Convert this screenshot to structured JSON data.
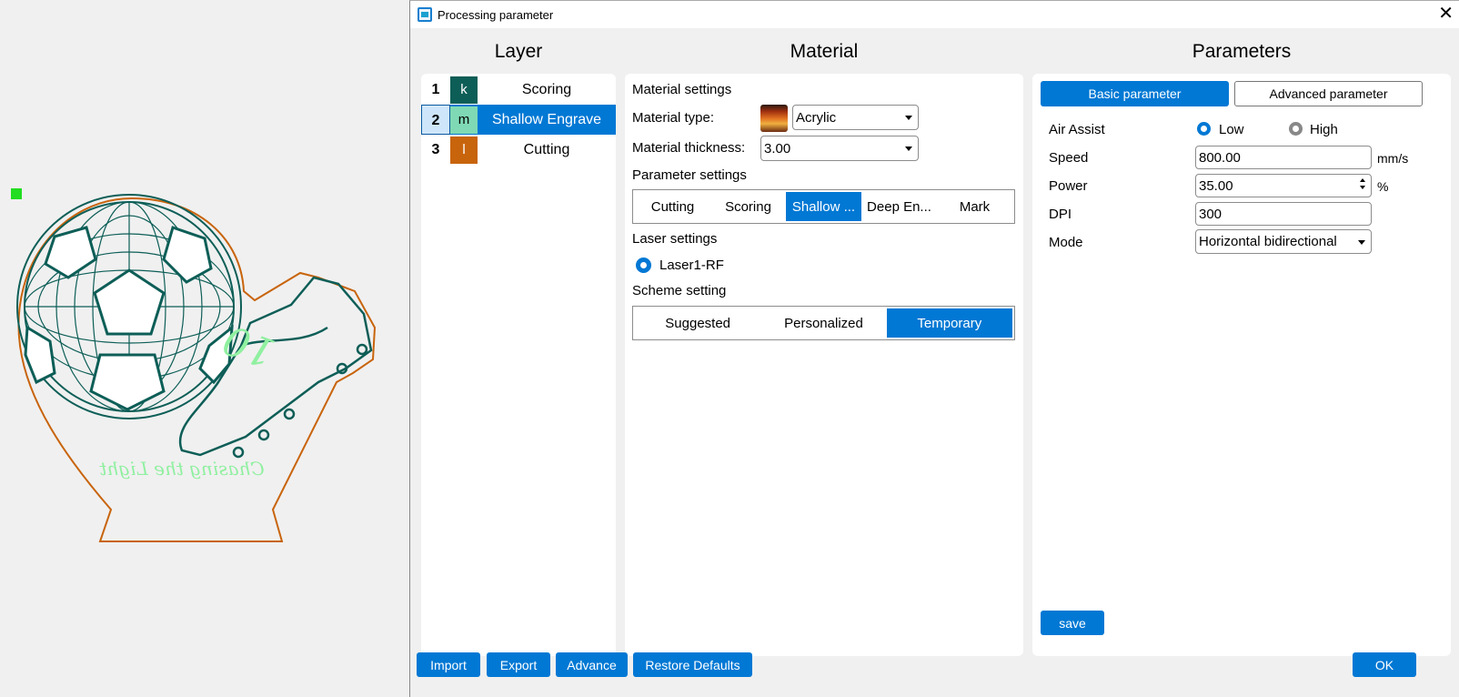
{
  "dialog": {
    "title": "Processing parameter",
    "close_glyph": "✕"
  },
  "columns": {
    "layer": "Layer",
    "material": "Material",
    "parameters": "Parameters"
  },
  "layers": [
    {
      "num": "1",
      "code": "k",
      "name": "Scoring",
      "color": "#0d5e57"
    },
    {
      "num": "2",
      "code": "m",
      "name": "Shallow Engrave",
      "color": "#7fd9b4",
      "selected": true
    },
    {
      "num": "3",
      "code": "l",
      "name": "Cutting",
      "color": "#c8640c"
    }
  ],
  "material": {
    "settings_label": "Material settings",
    "type_label": "Material type:",
    "type_value": "Acrylic",
    "thickness_label": "Material thickness:",
    "thickness_value": "3.00",
    "param_settings_label": "Parameter settings",
    "param_tabs": [
      "Cutting",
      "Scoring",
      "Shallow ...",
      "Deep En...",
      "Mark"
    ],
    "param_tab_active": 2,
    "laser_settings_label": "Laser settings",
    "laser_option": "Laser1-RF",
    "scheme_label": "Scheme setting",
    "scheme_tabs": [
      "Suggested",
      "Personalized",
      "Temporary"
    ],
    "scheme_tab_active": 2
  },
  "parameters": {
    "tab_basic": "Basic parameter",
    "tab_advanced": "Advanced parameter",
    "air_assist_label": "Air Assist",
    "air_low": "Low",
    "air_high": "High",
    "air_selected": "Low",
    "speed_label": "Speed",
    "speed_value": "800.00",
    "speed_unit": "mm/s",
    "power_label": "Power",
    "power_value": "35.00",
    "power_unit": "%",
    "dpi_label": "DPI",
    "dpi_value": "300",
    "mode_label": "Mode",
    "mode_value": "Horizontal bidirectional",
    "save_label": "save"
  },
  "footer": {
    "import": "Import",
    "export": "Export",
    "advance": "Advance",
    "restore": "Restore Defaults",
    "ok": "OK"
  },
  "canvas": {
    "number_text": "10",
    "tagline_text": "Chasing the Light",
    "line_color": "#0d5e57",
    "cut_color": "#c8640c",
    "engrave_color": "#90f0a0"
  },
  "colors": {
    "accent": "#0078d4"
  }
}
